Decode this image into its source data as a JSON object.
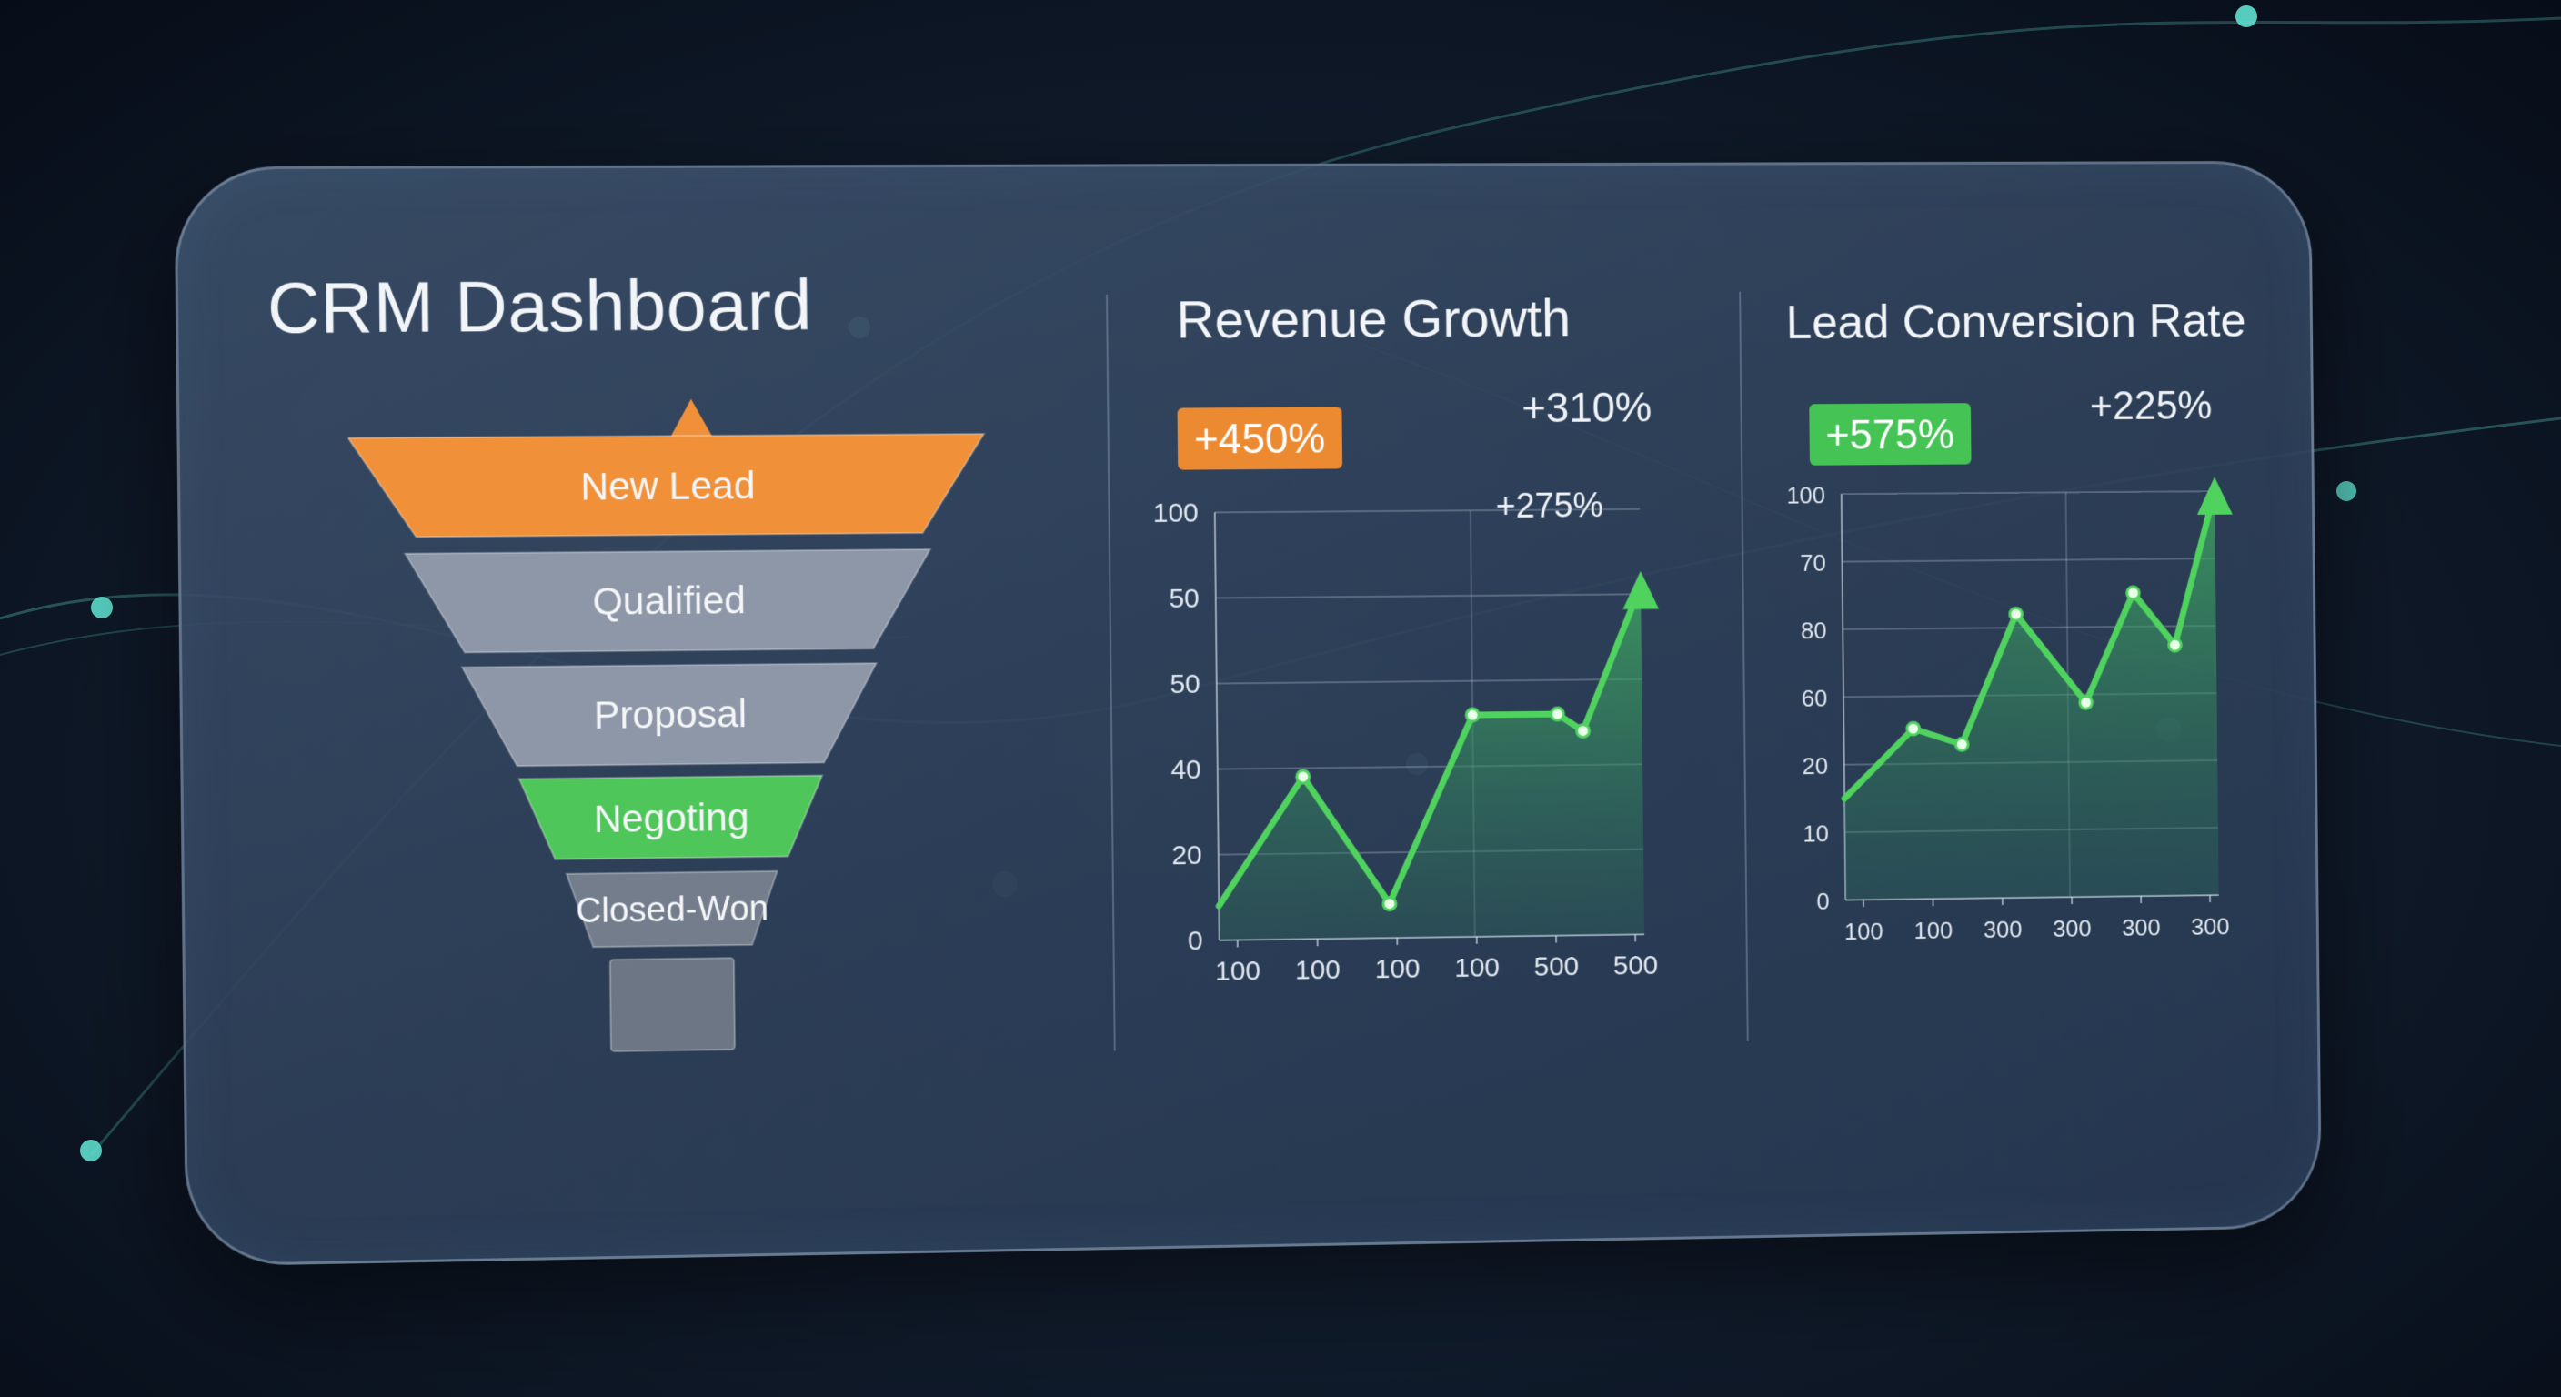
{
  "dashboard": {
    "title": "CRM Dashboard"
  },
  "funnel": {
    "stages": [
      {
        "label": "New Lead",
        "color": "#f0913a"
      },
      {
        "label": "Qualified",
        "color": "#8d97a8"
      },
      {
        "label": "Proposal",
        "color": "#8d97a8"
      },
      {
        "label": "Negoting",
        "color": "#4fc65a"
      },
      {
        "label": "Closed-Won",
        "color": "#737d8c"
      },
      {
        "label": "",
        "color": "#6c7685"
      }
    ]
  },
  "revenue": {
    "title": "Revenue Growth",
    "badge": "+450%",
    "badge_color": "#ec8a32",
    "delta_top": "+310%",
    "delta_inline": "+275%"
  },
  "conversion": {
    "title": "Lead Conversion Rate",
    "badge": "+575%",
    "badge_color": "#45c455",
    "delta_top": "+225%"
  },
  "chart_data": [
    {
      "type": "area",
      "title": "Revenue Growth",
      "y_tick_labels": [
        "100",
        "50",
        "50",
        "40",
        "20",
        "0"
      ],
      "x_tick_labels": [
        "100",
        "100",
        "100",
        "100",
        "500",
        "500"
      ],
      "ylim": [
        0,
        100
      ],
      "x": [
        0,
        1,
        2,
        3,
        4,
        4.3,
        5
      ],
      "values": [
        8,
        38,
        8,
        52,
        52,
        48,
        82
      ],
      "arrow": true,
      "grid": true,
      "line_color": "#4fd35e"
    },
    {
      "type": "area",
      "title": "Lead Conversion Rate",
      "y_tick_labels": [
        "100",
        "70",
        "80",
        "60",
        "20",
        "10",
        "0"
      ],
      "x_tick_labels": [
        "100",
        "100",
        "300",
        "300",
        "300",
        "300"
      ],
      "ylim": [
        0,
        100
      ],
      "x": [
        0,
        1,
        1.7,
        2.5,
        3.5,
        4.2,
        4.8,
        5.4
      ],
      "values": [
        25,
        42,
        38,
        70,
        48,
        75,
        62,
        100
      ],
      "arrow": true,
      "grid": true,
      "line_color": "#4fd35e"
    }
  ]
}
